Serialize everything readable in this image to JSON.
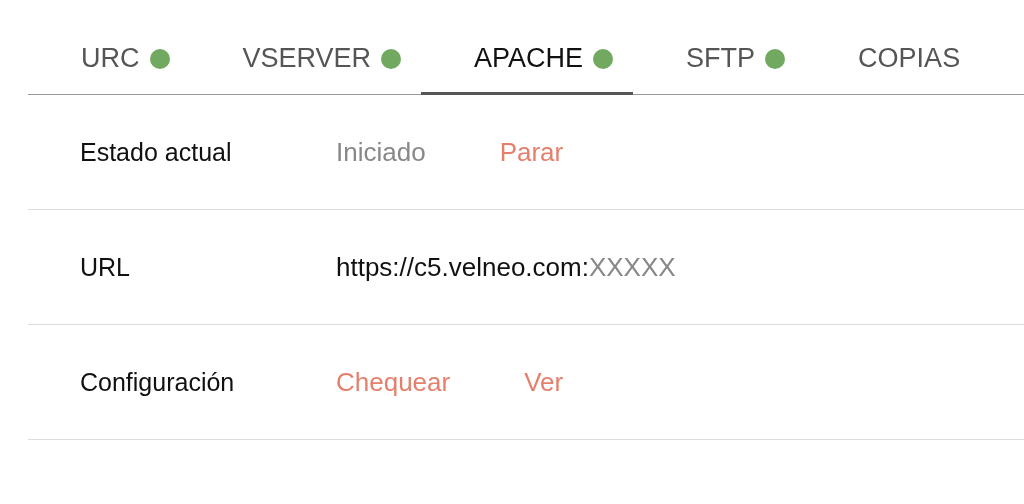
{
  "tabs": [
    {
      "label": "URC",
      "selected": false,
      "color": "#72a960"
    },
    {
      "label": "VSERVER",
      "selected": false,
      "color": "#72a960"
    },
    {
      "label": "APACHE",
      "selected": true,
      "color": "#72a960"
    },
    {
      "label": "SFTP",
      "selected": false,
      "color": "#72a960"
    },
    {
      "label": "COPIAS",
      "selected": false
    }
  ],
  "rows": [
    {
      "label": "Estado actual",
      "values": [
        [
          {
            "kind": "status",
            "text": "Iniciado"
          }
        ],
        [
          {
            "kind": "link",
            "text": "Parar"
          }
        ]
      ]
    },
    {
      "label": "URL",
      "values": [
        [
          {
            "kind": "value",
            "text": "https://c5.velneo.com:"
          },
          {
            "kind": "status",
            "text": "XXXXX"
          }
        ]
      ]
    },
    {
      "label": "Configuración",
      "values": [
        [
          {
            "kind": "link",
            "text": "Chequear"
          }
        ],
        [
          {
            "kind": "link",
            "text": "Ver"
          }
        ]
      ]
    }
  ]
}
